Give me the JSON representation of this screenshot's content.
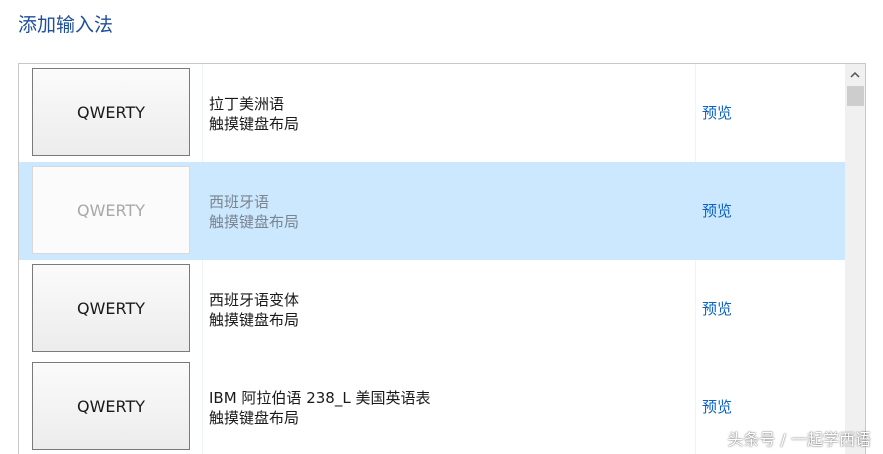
{
  "page": {
    "title": "添加输入法"
  },
  "list": {
    "rows": [
      {
        "keyboard_label": "QWERTY",
        "name": "拉丁美洲语",
        "layout": "触摸键盘布局",
        "preview_label": "预览",
        "selected": false
      },
      {
        "keyboard_label": "QWERTY",
        "name": "西班牙语",
        "layout": "触摸键盘布局",
        "preview_label": "预览",
        "selected": true
      },
      {
        "keyboard_label": "QWERTY",
        "name": "西班牙语变体",
        "layout": "触摸键盘布局",
        "preview_label": "预览",
        "selected": false
      },
      {
        "keyboard_label": "QWERTY",
        "name": "IBM 阿拉伯语 238_L 美国英语表",
        "layout": "触摸键盘布局",
        "preview_label": "预览",
        "selected": false
      }
    ]
  },
  "scrollbar": {
    "up_icon": "chevron-up-icon"
  },
  "watermark": {
    "text": "头条号 / 一起学西语"
  },
  "colors": {
    "title": "#1f4e99",
    "selected_row": "#cce8ff",
    "link": "#0b63c6"
  }
}
